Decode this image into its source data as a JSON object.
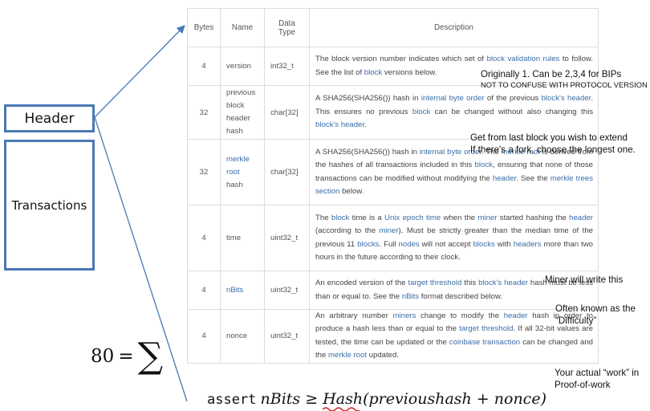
{
  "header_box": "Header",
  "transactions_box": "Transactions",
  "table": {
    "columns": [
      "Bytes",
      "Name",
      "Data\nType",
      "Description"
    ],
    "rows": [
      {
        "bytes": "4",
        "name": "version",
        "type": "int32_t",
        "desc": [
          {
            "t": "The block version number indicates which set of "
          },
          {
            "t": "block validation rules",
            "link": true
          },
          {
            "t": " to follow. See the list of "
          },
          {
            "t": "block",
            "link": true
          },
          {
            "t": " versions below."
          }
        ]
      },
      {
        "bytes": "32",
        "name": "previous block header hash",
        "type": "char[32]",
        "desc": [
          {
            "t": "A SHA256(SHA256()) hash in "
          },
          {
            "t": "internal byte order",
            "link": true
          },
          {
            "t": " of the previous "
          },
          {
            "t": "block's header",
            "link": true
          },
          {
            "t": ". This ensures no previous "
          },
          {
            "t": "block",
            "link": true
          },
          {
            "t": " can be changed without also changing this "
          },
          {
            "t": "block's header",
            "link": true
          },
          {
            "t": "."
          }
        ]
      },
      {
        "bytes": "32",
        "name": "merkle root",
        "name_link": true,
        "name_suffix": "hash",
        "type": "char[32]",
        "desc": [
          {
            "t": "A SHA256(SHA256()) hash in "
          },
          {
            "t": "internal byte order",
            "link": true
          },
          {
            "t": ". The "
          },
          {
            "t": "merkle root",
            "link": true
          },
          {
            "t": " is derived from the hashes of all transactions included in this "
          },
          {
            "t": "block",
            "link": true
          },
          {
            "t": ", ensuring that none of those transactions can be modified without modifying the "
          },
          {
            "t": "header",
            "link": true
          },
          {
            "t": ". See the "
          },
          {
            "t": "merkle trees section",
            "link": true
          },
          {
            "t": " below."
          }
        ]
      },
      {
        "bytes": "4",
        "name": "time",
        "type": "uint32_t",
        "desc": [
          {
            "t": "The "
          },
          {
            "t": "block",
            "link": true
          },
          {
            "t": " time is a "
          },
          {
            "t": "Unix epoch time",
            "link": true
          },
          {
            "t": " when the "
          },
          {
            "t": "miner",
            "link": true
          },
          {
            "t": " started hashing the "
          },
          {
            "t": "header",
            "link": true
          },
          {
            "t": " (according to the "
          },
          {
            "t": "miner",
            "link": true
          },
          {
            "t": "). Must be strictly greater than the median time of the previous 11 "
          },
          {
            "t": "blocks",
            "link": true
          },
          {
            "t": ". Full "
          },
          {
            "t": "nodes",
            "link": true
          },
          {
            "t": " will not accept "
          },
          {
            "t": "blocks",
            "link": true
          },
          {
            "t": " with "
          },
          {
            "t": "headers",
            "link": true
          },
          {
            "t": " more than two hours in the future according to their clock."
          }
        ]
      },
      {
        "bytes": "4",
        "name": "nBits",
        "name_link": true,
        "type": "uint32_t",
        "desc": [
          {
            "t": "An encoded version of the "
          },
          {
            "t": "target threshold",
            "link": true
          },
          {
            "t": " this "
          },
          {
            "t": "block's header",
            "link": true
          },
          {
            "t": " hash must be less than or equal to. See the "
          },
          {
            "t": "nBits",
            "link": true
          },
          {
            "t": " format described below."
          }
        ]
      },
      {
        "bytes": "4",
        "name": "nonce",
        "type": "uint32_t",
        "desc": [
          {
            "t": "An arbitrary number "
          },
          {
            "t": "miners",
            "link": true
          },
          {
            "t": " change to modify the "
          },
          {
            "t": "header",
            "link": true
          },
          {
            "t": " hash in order to produce a hash less than or equal to the "
          },
          {
            "t": "target threshold",
            "link": true
          },
          {
            "t": ". If all 32-bit values are tested, the time can be updated or the "
          },
          {
            "t": "coinbase transaction",
            "link": true
          },
          {
            "t": " can be changed and the "
          },
          {
            "t": "merkle root",
            "link": true
          },
          {
            "t": " updated."
          }
        ]
      }
    ]
  },
  "annotations": {
    "version_1": "Originally 1. Can be 2,3,4 for BIPs",
    "version_2": "NOT TO CONFUSE WITH PROTOCOL VERSION",
    "prev_1": "Get from last block you wish to extend",
    "prev_2": "If there's a fork, choose the longest one.",
    "nbits_1": "Miner will write this",
    "nbits_2": "Often known as the",
    "nbits_3": "“Difficulty”",
    "nonce_1": "Your actual “work” in",
    "nonce_2": "Proof-of-work"
  },
  "sum_number": "80",
  "sum_eq": "=",
  "sum_symbol": "∑",
  "assert_keyword": "assert",
  "assert_lhs": "nBits ≥ ",
  "assert_hash": "Hash",
  "assert_rhs": "(previoushash + nonce)",
  "colors": {
    "box_border": "#4a78b4",
    "link": "#3b6ea8",
    "squiggle": "#d02020"
  }
}
